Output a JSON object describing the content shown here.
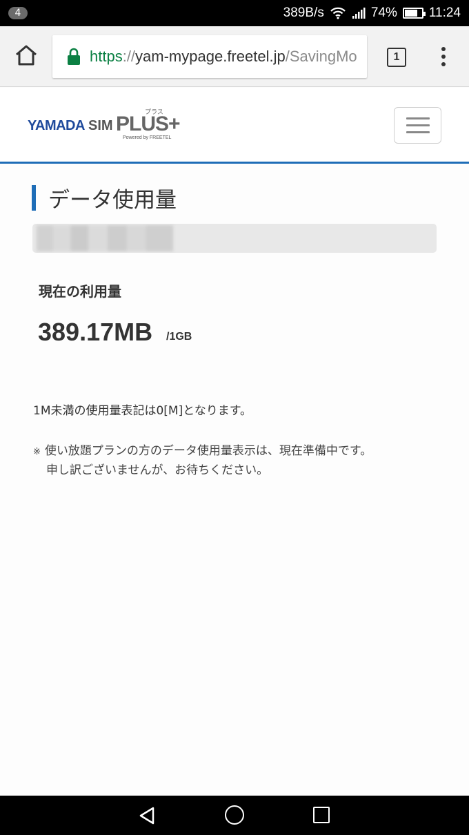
{
  "status_bar": {
    "notification_count": "4",
    "net_speed": "389B/s",
    "battery_percent": "74%",
    "battery_level": 0.74,
    "time": "11:24"
  },
  "browser": {
    "url_scheme": "https",
    "url_sep": "://",
    "url_host": "yam-mypage.freetel.jp",
    "url_path": "/SavingMo",
    "tab_count": "1",
    "secure_color": "#0b8043"
  },
  "site": {
    "logo_yamada": "YAMADA",
    "logo_sim": "SIM",
    "logo_plus": "PLUS+",
    "logo_ruby": "プラス",
    "logo_powered": "Powered by FREETEL",
    "accent_color": "#1e6db7"
  },
  "main": {
    "page_title": "データ使用量",
    "usage_label": "現在の利用量",
    "usage_value": "389.17MB",
    "usage_limit": "/1GB",
    "note_min": "1M未満の使用量表記は0[M]となります。",
    "note_mark": "※",
    "note_unlimited_line1": "使い放題プランの方のデータ使用量表示は、現在準備中です。",
    "note_unlimited_line2": "申し訳ございませんが、お待ちください。"
  }
}
